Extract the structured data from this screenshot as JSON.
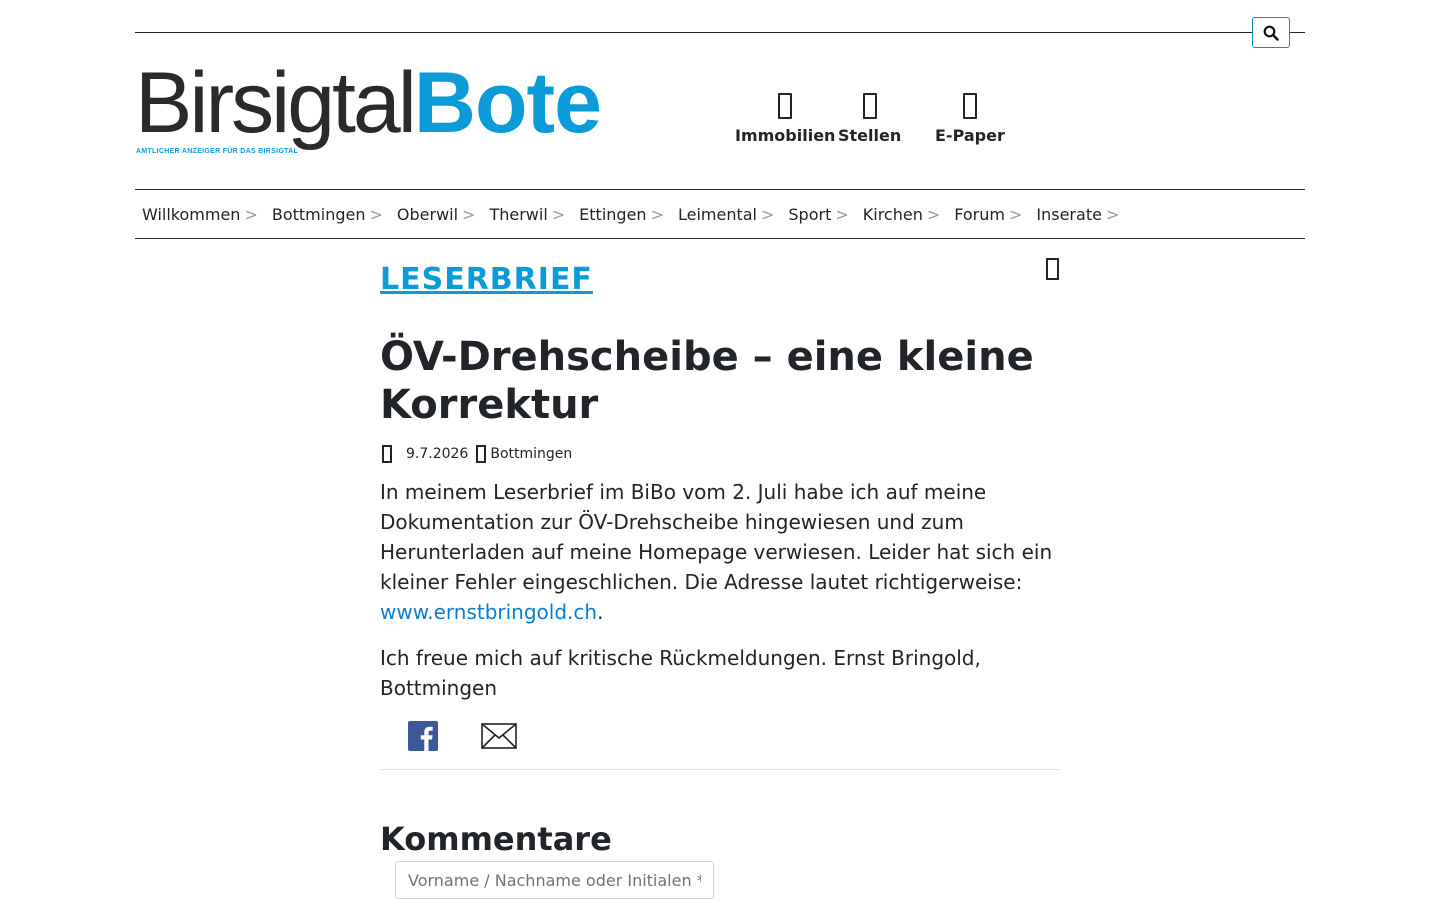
{
  "header": {
    "logo_part1": "Birsigtal",
    "logo_part2": "Bote",
    "logo_tagline": "AMTLICHER ANZEIGER FÜR DAS BIRSIGTAL",
    "quick_links": [
      {
        "label": "Immobilien",
        "icon": "house-icon"
      },
      {
        "label": "Stellen",
        "icon": "briefcase-icon"
      },
      {
        "label": "E-Paper",
        "icon": "newspaper-icon"
      }
    ],
    "search_icon": "search-icon"
  },
  "nav": {
    "items": [
      "Willkommen",
      "Bottmingen",
      "Oberwil",
      "Therwil",
      "Ettingen",
      "Leimental",
      "Sport",
      "Kirchen",
      "Forum",
      "Inserate"
    ],
    "chevron": ">"
  },
  "article": {
    "category": "LESERBRIEF",
    "title": "ÖV-Drehscheibe – eine kleine Korrektur",
    "date": "9.7.2026",
    "location": "Bottmingen",
    "paragraph1": "In meinem Leserbrief im BiBo vom 2. Juli habe ich auf meine Dokumentation zur ÖV-Drehscheibe hingewiesen und zum Herunterladen auf meine Homepage verwiesen. Leider hat sich ein kleiner Fehler eingeschlichen. Die Adresse lautet richtigerweise: ",
    "link": "www.ernstbringold.ch",
    "paragraph1_end": ".",
    "paragraph2": "Ich freue mich auf kritische Rückmeldungen. Ernst Bringold, Bottmingen"
  },
  "comments": {
    "heading": "Kommentare",
    "name_placeholder": "Vorname / Nachname oder Initialen *"
  },
  "colors": {
    "brand_blue": "#0a9bd8",
    "text": "#212529",
    "facebook": "#3b5998"
  }
}
